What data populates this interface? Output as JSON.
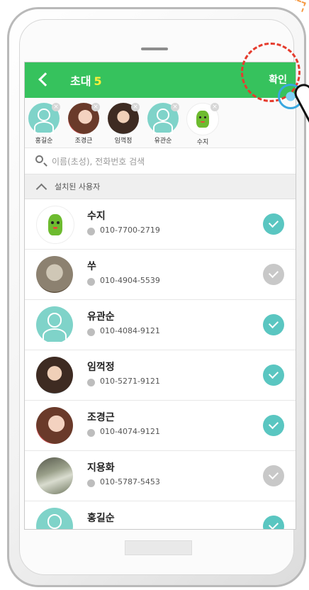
{
  "header": {
    "title": "초대",
    "count": "5",
    "confirm_label": "확인"
  },
  "selected": [
    {
      "name": "홍길순",
      "avatar": "default"
    },
    {
      "name": "조경근",
      "avatar": "girl1"
    },
    {
      "name": "임꺽정",
      "avatar": "girl2"
    },
    {
      "name": "유관순",
      "avatar": "default"
    },
    {
      "name": "수지",
      "avatar": "cactus"
    }
  ],
  "search": {
    "placeholder": "이름(초성), 전화번호 검색"
  },
  "section": {
    "label": "설치된 사용자"
  },
  "contacts": [
    {
      "name": "수지",
      "phone": "010-7700-2719",
      "checked": true
    },
    {
      "name": "쑤",
      "phone": "010-4904-5539",
      "checked": false
    },
    {
      "name": "유관순",
      "phone": "010-4084-9121",
      "checked": true
    },
    {
      "name": "임꺽정",
      "phone": "010-5271-9121",
      "checked": true
    },
    {
      "name": "조경근",
      "phone": "010-4074-9121",
      "checked": true
    },
    {
      "name": "지용화",
      "phone": "010-5787-5453",
      "checked": false
    },
    {
      "name": "홍길순",
      "phone": "",
      "checked": true
    }
  ],
  "colors": {
    "header_bg": "#36c25d",
    "count_color": "#ffef3a",
    "check_on": "#5ac6c1",
    "check_off": "#c8c8c8",
    "ring": "#e53b2d"
  }
}
